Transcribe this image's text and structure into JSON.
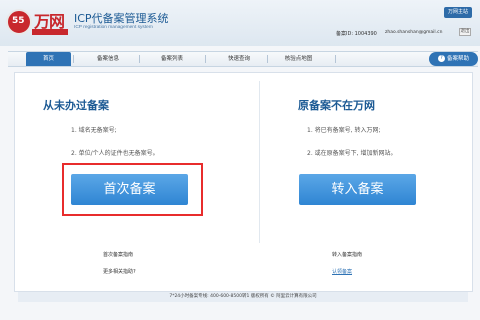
{
  "header": {
    "logo_badge": "55",
    "logo_text": "万网",
    "system_title": "ICP代备案管理系统",
    "system_subtitle": "ICP registration management system",
    "help_link": "万网主站",
    "account_label": "备案ID: 1004390",
    "email": "zhao.shanshan@gmail.cn",
    "logout": "退出"
  },
  "nav": {
    "items": [
      "首页",
      "备案信息",
      "备案列表",
      "快速查询",
      "核验点地图"
    ],
    "help_button": "备案帮助",
    "help_icon": "question-icon"
  },
  "left_column": {
    "title": "从未办过备案",
    "lines": [
      "1. 域名无备案号;",
      "2. 单位/个人的证件也无备案号。"
    ],
    "button": "首次备案",
    "guide_title": "首次备案指南",
    "guide_more": "更多相关指助?"
  },
  "right_column": {
    "title": "原备案不在万网",
    "lines": [
      "1. 将已有备案号, 转入万网;",
      "2. 或在原备案号下, 增加新网站。"
    ],
    "button": "转入备案",
    "guide_title": "转入备案指南",
    "guide_link": "认领备案"
  },
  "footer": {
    "text": "7*24小时备案专线: 400-600-8500转1 版权所有 © 阿里云计算有限公司"
  },
  "colors": {
    "brand_red": "#c8282d",
    "brand_blue": "#2f73b5",
    "highlight_red": "#e82c2c"
  }
}
